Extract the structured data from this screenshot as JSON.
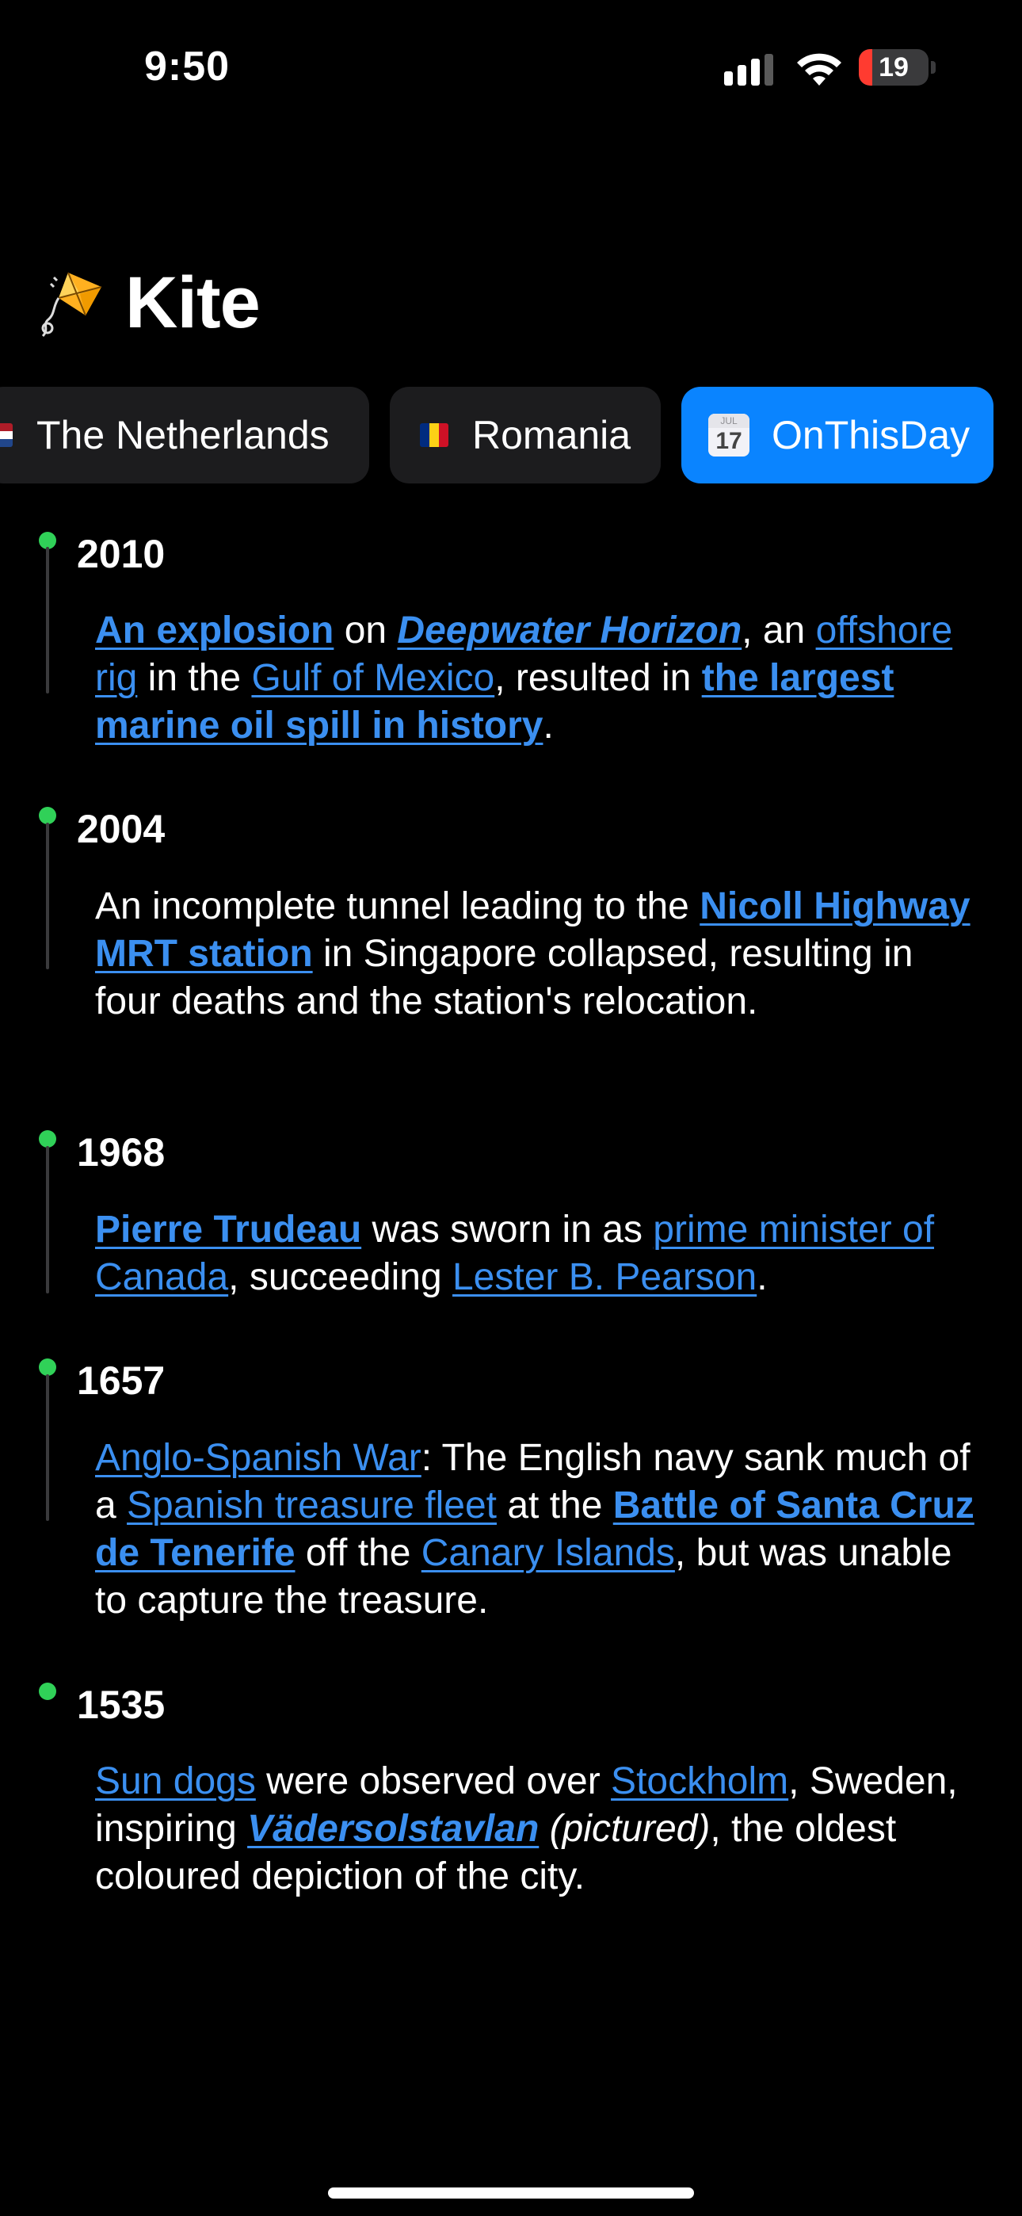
{
  "status": {
    "time": "9:50",
    "battery_percent": "19",
    "battery_level": 0.19,
    "battery_color": "#ff3b30"
  },
  "app": {
    "title": "Kite",
    "icon": "kite-icon"
  },
  "tabs": [
    {
      "label": "The Netherlands",
      "icon": "netherlands-flag-icon",
      "active": false
    },
    {
      "label": "Romania",
      "icon": "romania-flag-icon",
      "active": false
    },
    {
      "label": "OnThisDay",
      "icon": "calendar-icon",
      "active": true
    }
  ],
  "events": [
    {
      "year": "2010",
      "segments": [
        {
          "t": "An explosion",
          "link": true,
          "bold": true
        },
        {
          "t": " on "
        },
        {
          "t": "Deepwater Horizon",
          "link": true,
          "bold": true,
          "italic": true
        },
        {
          "t": ", an "
        },
        {
          "t": "offshore rig",
          "link": true
        },
        {
          "t": " in the "
        },
        {
          "t": "Gulf of Mexico",
          "link": true
        },
        {
          "t": ", resulted in "
        },
        {
          "t": "the largest marine oil spill in history",
          "link": true,
          "bold": true
        },
        {
          "t": "."
        }
      ]
    },
    {
      "year": "2004",
      "segments": [
        {
          "t": "An incomplete tunnel leading to the "
        },
        {
          "t": "Nicoll Highway MRT station",
          "link": true,
          "bold": true
        },
        {
          "t": " in Singapore collapsed, resulting in four deaths and the station's relocation."
        }
      ]
    },
    {
      "year": "1968",
      "segments": [
        {
          "t": "Pierre Trudeau",
          "link": true,
          "bold": true
        },
        {
          "t": " was sworn in as "
        },
        {
          "t": "prime minister of Canada",
          "link": true
        },
        {
          "t": ", succeeding "
        },
        {
          "t": "Lester B. Pearson",
          "link": true
        },
        {
          "t": "."
        }
      ]
    },
    {
      "year": "1657",
      "segments": [
        {
          "t": "Anglo-Spanish War",
          "link": true
        },
        {
          "t": ": The English navy sank much of a "
        },
        {
          "t": "Spanish treasure fleet",
          "link": true
        },
        {
          "t": " at the "
        },
        {
          "t": "Battle of Santa Cruz de Tenerife",
          "link": true,
          "bold": true
        },
        {
          "t": " off the "
        },
        {
          "t": "Canary Islands",
          "link": true
        },
        {
          "t": ", but was unable to capture the treasure."
        }
      ]
    },
    {
      "year": "1535",
      "segments": [
        {
          "t": "Sun dogs",
          "link": true
        },
        {
          "t": " were observed over "
        },
        {
          "t": "Stockholm",
          "link": true
        },
        {
          "t": ", Sweden, inspiring "
        },
        {
          "t": "Vädersolstavlan",
          "link": true,
          "bold": true,
          "italic": true
        },
        {
          "t": " "
        },
        {
          "t": "(pictured)",
          "italic": true
        },
        {
          "t": ", the oldest coloured depiction of the city."
        }
      ]
    }
  ],
  "colors": {
    "background": "#000000",
    "link": "#3b8ff0",
    "accent": "#0a84ff",
    "timeline_dot": "#30d158",
    "tab_bg": "#1c1c1e"
  }
}
